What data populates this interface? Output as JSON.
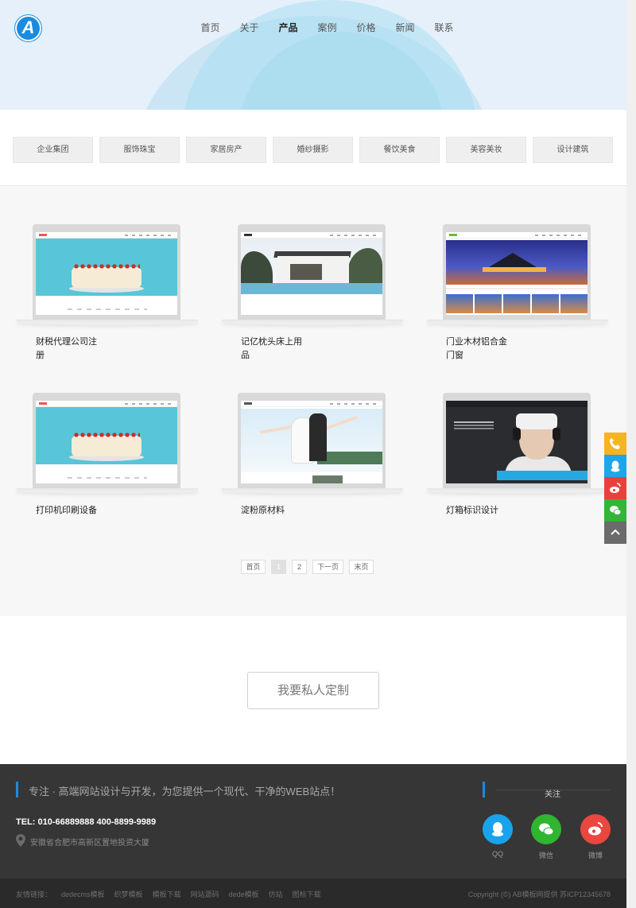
{
  "header": {
    "logo_letter": "A",
    "nav": [
      "首页",
      "关于",
      "产品",
      "案例",
      "价格",
      "新闻",
      "联系"
    ],
    "active_nav": "产品"
  },
  "categories": [
    "企业集团",
    "服饰珠宝",
    "家居房产",
    "婚纱摄影",
    "餐饮美食",
    "美容美妆",
    "设计建筑"
  ],
  "products": [
    {
      "title_line1": "财税代理公司注",
      "title_line2": "册",
      "thumb": "cake"
    },
    {
      "title_line1": "记亿枕头床上用",
      "title_line2": "品",
      "thumb": "house"
    },
    {
      "title_line1": "门业木材铝合金",
      "title_line2": "门窗",
      "thumb": "resort"
    },
    {
      "title_line1": "打印机印刷设备",
      "title_line2": "",
      "thumb": "cake"
    },
    {
      "title_line1": "淀粉原材料",
      "title_line2": "",
      "thumb": "wedding"
    },
    {
      "title_line1": "灯箱标识设计",
      "title_line2": "",
      "thumb": "vr"
    }
  ],
  "pagination": {
    "first": "首页",
    "pages": [
      "1",
      "2"
    ],
    "current": "1",
    "next": "下一页",
    "last": "末页"
  },
  "custom_button": "我要私人定制",
  "footer": {
    "tagline": "专注 · 高端网站设计与开发，为您提供一个现代、干净的WEB站点！",
    "tel": "TEL: 010-66889888 400-8899-9989",
    "address": "安徽省合肥市高新区置地投资大厦",
    "follow": "关注",
    "social": [
      {
        "label": "QQ",
        "color": "#19a3ec",
        "icon": "qq-icon"
      },
      {
        "label": "微信",
        "color": "#2fb52f",
        "icon": "wechat-icon"
      },
      {
        "label": "微博",
        "color": "#e9473f",
        "icon": "weibo-icon"
      }
    ],
    "links_label": "友情链接：",
    "links": [
      "dedecms模板",
      "织梦模板",
      "模板下载",
      "网站源码",
      "dede模板",
      "仿站",
      "图标下载"
    ],
    "copyright": "Copyright (©) AB模板网提供 苏ICP12345678"
  },
  "float_bar": [
    {
      "icon": "phone-icon",
      "color": "#f6b324"
    },
    {
      "icon": "qq-icon",
      "color": "#1ea5ea"
    },
    {
      "icon": "weibo-icon",
      "color": "#e8413c"
    },
    {
      "icon": "wechat-icon",
      "color": "#35b43a"
    },
    {
      "icon": "back-to-top-icon",
      "color": "#6b6b6b"
    }
  ]
}
